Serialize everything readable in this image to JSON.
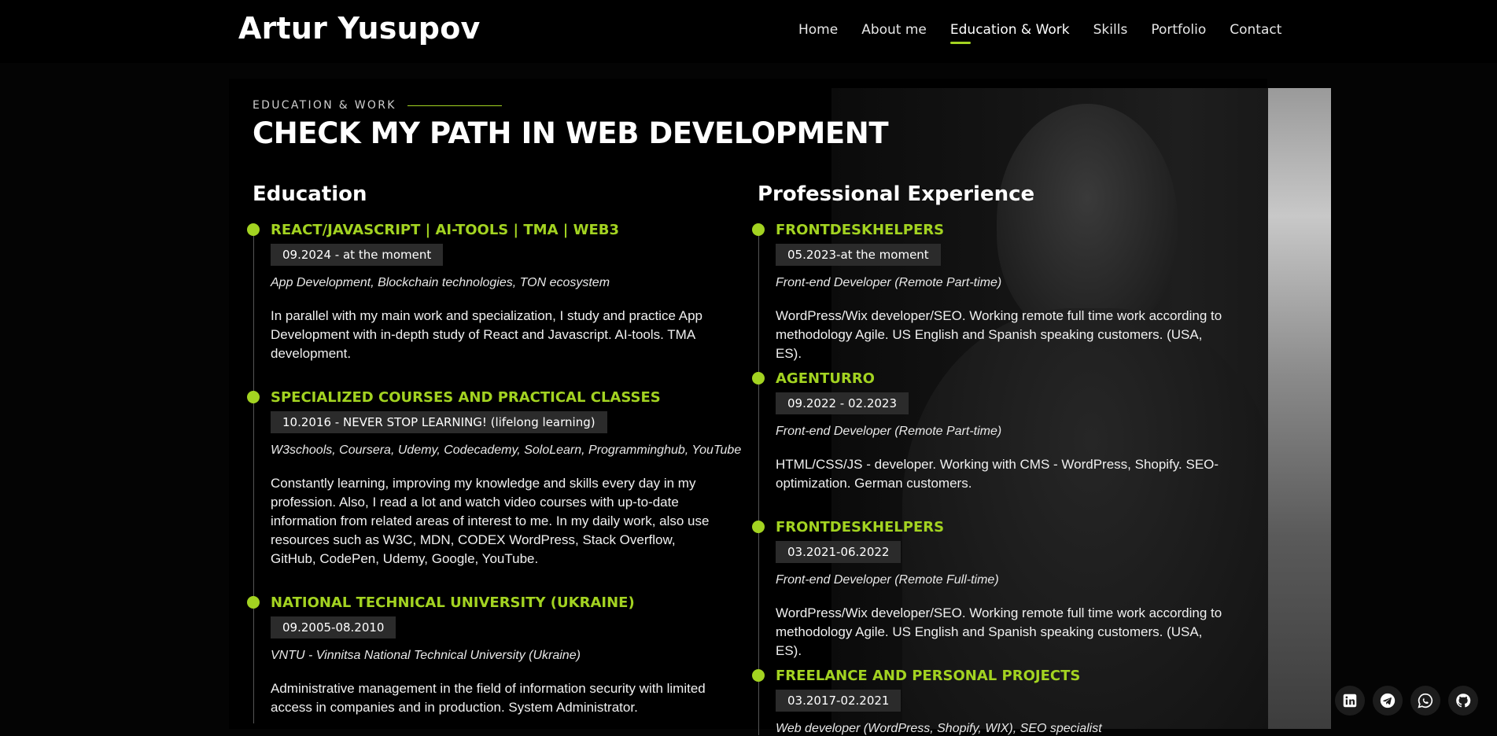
{
  "header": {
    "logo": "Artur Yusupov",
    "nav": [
      "Home",
      "About me",
      "Education & Work",
      "Skills",
      "Portfolio",
      "Contact"
    ]
  },
  "section": {
    "eyebrow": "EDUCATION & WORK",
    "title": "CHECK MY PATH IN WEB DEVELOPMENT"
  },
  "education": {
    "title": "Education",
    "items": [
      {
        "name": "REACT/JAVASCRIPT | AI-TOOLS | TMA | WEB3",
        "date": "09.2024 - at the moment",
        "subtitle": "App Development, Blockchain technologies, TON ecosystem",
        "desc": "In parallel with my main work and specialization, I study and practice App Development with in-depth study of React and Javascript. AI-tools. TMA development."
      },
      {
        "name": "SPECIALIZED COURSES AND PRACTICAL CLASSES",
        "date": "10.2016 - NEVER STOP LEARNING! (lifelong learning)",
        "subtitle": "W3schools, Coursera, Udemy, Codecademy, SoloLearn, Programminghub, YouTube",
        "desc": "Constantly learning, improving my knowledge and skills every day in my profession. Also, I read a lot and watch video courses with up-to-date information from related areas of interest to me. In my daily work, also use resources such as W3C, MDN, CODEX WordPress, Stack Overflow, GitHub, CodePen, Udemy, Google, YouTube."
      },
      {
        "name": "NATIONAL TECHNICAL UNIVERSITY (UKRAINE)",
        "date": "09.2005-08.2010",
        "subtitle": "VNTU - Vinnitsa National Technical University (Ukraine)",
        "desc": "Administrative management in the field of information security with limited access in companies and in production. System Administrator."
      }
    ]
  },
  "experience": {
    "title": "Professional Experience",
    "items": [
      {
        "name": "FRONTDESKHELPERS",
        "date": "05.2023-at the moment",
        "subtitle": "Front-end Developer (Remote Part-time)",
        "desc": "WordPress/Wix developer/SEO. Working remote full time work according to methodology Agile. US English and Spanish speaking customers. (USA, ES)."
      },
      {
        "name": "AGENTURRO",
        "date": "09.2022 - 02.2023",
        "subtitle": "Front-end Developer (Remote Part-time)",
        "desc": "HTML/CSS/JS - developer. Working with CMS - WordPress, Shopify. SEO-optimization. German customers."
      },
      {
        "name": "FRONTDESKHELPERS",
        "date": "03.2021-06.2022",
        "subtitle": "Front-end Developer (Remote Full-time)",
        "desc": "WordPress/Wix developer/SEO. Working remote full time work according to methodology Agile. US English and Spanish speaking customers. (USA, ES)."
      },
      {
        "name": "FREELANCE AND PERSONAL PROJECTS",
        "date": "03.2017-02.2021",
        "subtitle": "Web developer (WordPress, Shopify, WIX), SEO specialist",
        "desc": ""
      }
    ]
  },
  "socials": [
    "linkedin-icon",
    "telegram-icon",
    "whatsapp-icon",
    "github-icon"
  ],
  "colors": {
    "accent": "#a3d321",
    "background": "#000000",
    "date_badge": "#2b2b2b"
  }
}
